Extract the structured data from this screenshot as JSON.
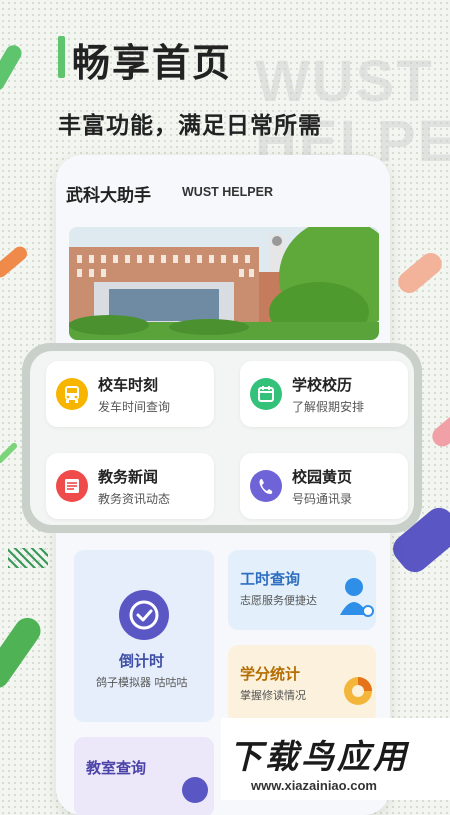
{
  "hero": {
    "title": "畅享首页",
    "subtitle": "丰富功能，满足日常所需",
    "watermark_line1": "WUST",
    "watermark_line2": "HELPER"
  },
  "app": {
    "name": "武科大助手",
    "name_en": "WUST HELPER"
  },
  "features": [
    {
      "title": "校车时刻",
      "subtitle": "发车时间查询",
      "icon": "bus-icon",
      "color": "#f7b500"
    },
    {
      "title": "学校校历",
      "subtitle": "了解假期安排",
      "icon": "calendar-icon",
      "color": "#34c27a"
    },
    {
      "title": "教务新闻",
      "subtitle": "教务资讯动态",
      "icon": "newspaper-icon",
      "color": "#ef4b4b"
    },
    {
      "title": "校园黄页",
      "subtitle": "号码通讯录",
      "icon": "phone-icon",
      "color": "#6e64d8"
    }
  ],
  "cards": {
    "countdown": {
      "title": "倒计时",
      "subtitle": "鸽子模拟器 咕咕咕",
      "icon": "clock-icon",
      "color": "#5a57c4"
    },
    "worktime": {
      "title": "工时查询",
      "subtitle": "志愿服务便捷达",
      "icon": "person-icon",
      "color": "#2f8fe8"
    },
    "credits": {
      "title": "学分统计",
      "subtitle": "掌握修读情况",
      "icon": "pie-chart-icon",
      "color": "#e89a1a"
    },
    "classroom": {
      "title": "教室查询",
      "icon": "classroom-icon",
      "color": "#5a57c4"
    }
  },
  "brand": {
    "name": "下载鸟应用",
    "url": "www.xiazainiao.com"
  }
}
